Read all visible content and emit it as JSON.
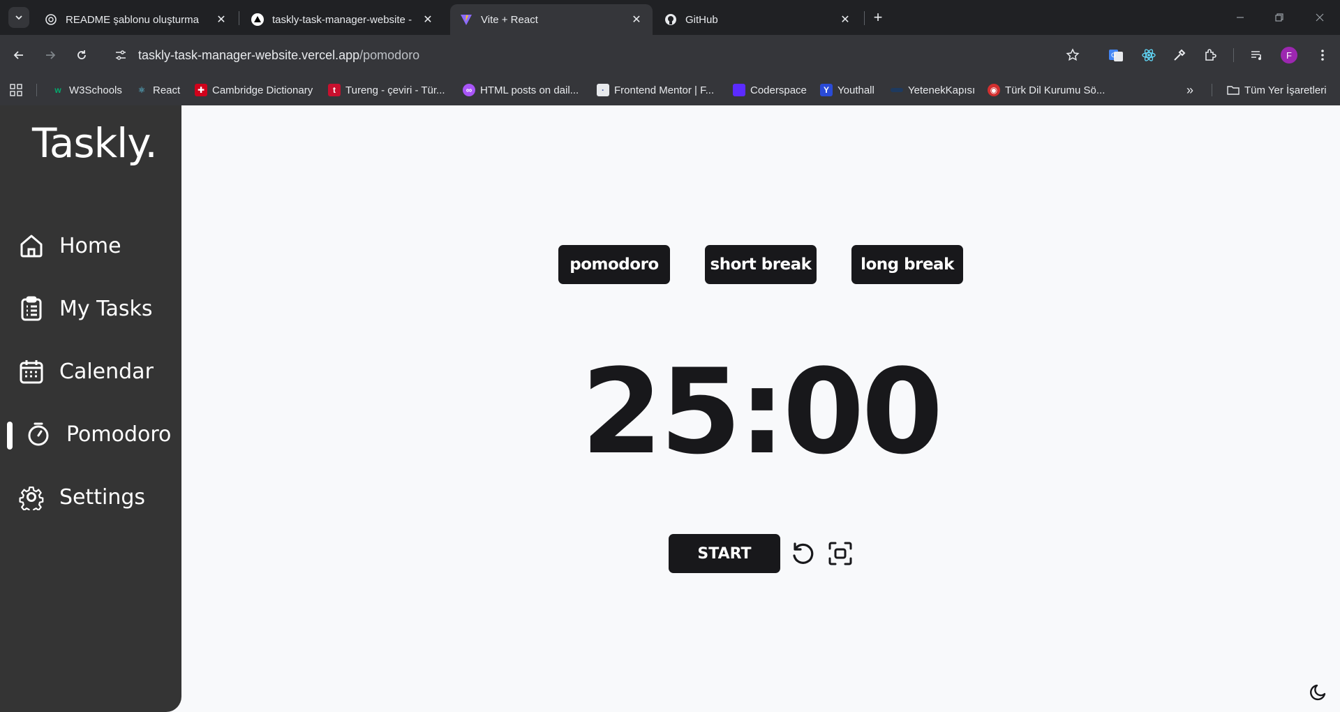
{
  "browser": {
    "tabs": [
      {
        "title": "README şablonu oluşturma",
        "icon": "openai-icon",
        "active": false
      },
      {
        "title": "taskly-task-manager-website - ",
        "icon": "vercel-icon",
        "active": false
      },
      {
        "title": "Vite + React",
        "icon": "vite-icon",
        "active": true
      },
      {
        "title": "GitHub",
        "icon": "github-icon",
        "active": false
      }
    ],
    "url": {
      "host": "taskly-task-manager-website.vercel.app",
      "path": "/pomodoro"
    },
    "profile_initial": "F",
    "bookmarks": [
      {
        "label": "W3Schools",
        "icon": "w3schools-icon",
        "color": "#04aa6d"
      },
      {
        "label": "React",
        "icon": "react-icon",
        "color": "#61dafb"
      },
      {
        "label": "Cambridge Dictionary",
        "icon": "cambridge-icon",
        "color": "#d0021b"
      },
      {
        "label": "Tureng - çeviri - Tür...",
        "icon": "tureng-icon",
        "color": "#c8102e"
      },
      {
        "label": "HTML posts on dail...",
        "icon": "dailydev-icon",
        "color": "#a855f7"
      },
      {
        "label": "Frontend Mentor | F...",
        "icon": "frontendmentor-icon",
        "color": "#e8eaed"
      },
      {
        "label": "Coderspace",
        "icon": "coderspace-icon",
        "color": "#5b2bff"
      },
      {
        "label": "Youthall",
        "icon": "youthall-icon",
        "color": "#2a4bd7"
      },
      {
        "label": "YetenekKapısı",
        "icon": "yetenekkapisi-icon",
        "color": "#1e3a5f"
      },
      {
        "label": "Türk Dil Kurumu Sö...",
        "icon": "tdk-icon",
        "color": "#d32f2f"
      }
    ],
    "all_bookmarks_label": "Tüm Yer İşaretleri"
  },
  "sidebar": {
    "brand": "Taskly.",
    "items": [
      {
        "label": "Home",
        "icon": "home-icon"
      },
      {
        "label": "My Tasks",
        "icon": "clipboard-list-icon"
      },
      {
        "label": "Calendar",
        "icon": "calendar-icon"
      },
      {
        "label": "Pomodoro",
        "icon": "stopwatch-icon",
        "active": true
      },
      {
        "label": "Settings",
        "icon": "gear-icon"
      }
    ]
  },
  "pomodoro": {
    "modes": [
      "pomodoro",
      "short break",
      "long break"
    ],
    "time": "25:00",
    "start_label": "START"
  },
  "colors": {
    "sidebar_bg": "#343434",
    "button_bg": "#18181b",
    "page_bg": "#f8f9fb"
  }
}
